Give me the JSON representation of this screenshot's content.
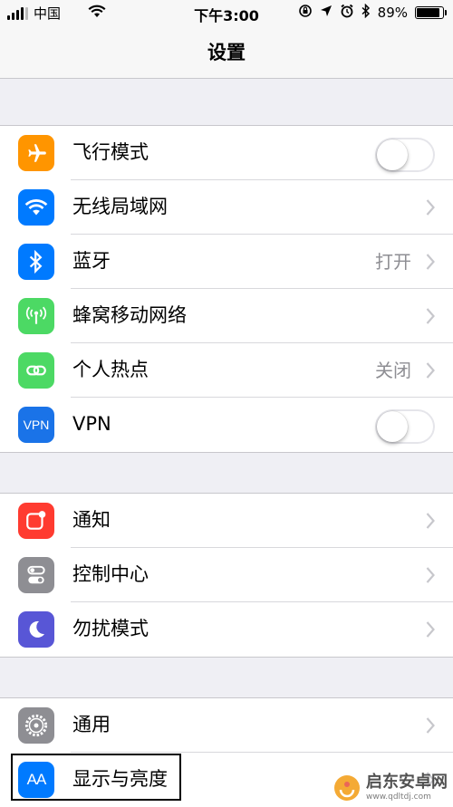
{
  "status_bar": {
    "carrier": "中国",
    "time": "下午3:00",
    "battery": "89%",
    "battery_level": 0.89
  },
  "nav": {
    "title": "设置"
  },
  "groups": [
    {
      "rows": [
        {
          "label": "飞行模式",
          "control": "toggle",
          "on": false,
          "icon": "airplane-icon",
          "icon_color": "#ff9500"
        },
        {
          "label": "无线局域网",
          "control": "chevron",
          "icon": "wifi-icon",
          "icon_color": "#007aff"
        },
        {
          "label": "蓝牙",
          "value": "打开",
          "control": "chevron",
          "icon": "bluetooth-icon",
          "icon_color": "#007aff"
        },
        {
          "label": "蜂窝移动网络",
          "control": "chevron",
          "icon": "cellular-icon",
          "icon_color": "#4cd964"
        },
        {
          "label": "个人热点",
          "value": "关闭",
          "control": "chevron",
          "icon": "hotspot-icon",
          "icon_color": "#4cd964"
        },
        {
          "label": "VPN",
          "control": "toggle",
          "on": false,
          "icon": "vpn-icon",
          "icon_text": "VPN",
          "icon_color": "#1a73e8"
        }
      ]
    },
    {
      "rows": [
        {
          "label": "通知",
          "control": "chevron",
          "icon": "notifications-icon",
          "icon_color": "#ff3b30"
        },
        {
          "label": "控制中心",
          "control": "chevron",
          "icon": "control-center-icon",
          "icon_color": "#8e8e93"
        },
        {
          "label": "勿扰模式",
          "control": "chevron",
          "icon": "moon-icon",
          "icon_color": "#5856d6"
        }
      ]
    },
    {
      "rows": [
        {
          "label": "通用",
          "control": "chevron",
          "icon": "gear-icon",
          "icon_color": "#8e8e93"
        },
        {
          "label": "显示与亮度",
          "control": "chevron",
          "icon": "display-brightness-icon",
          "icon_text": "AA",
          "icon_color": "#007aff"
        }
      ]
    }
  ],
  "watermark": {
    "title": "启东安卓网",
    "url": "www.qdltdj.com"
  }
}
